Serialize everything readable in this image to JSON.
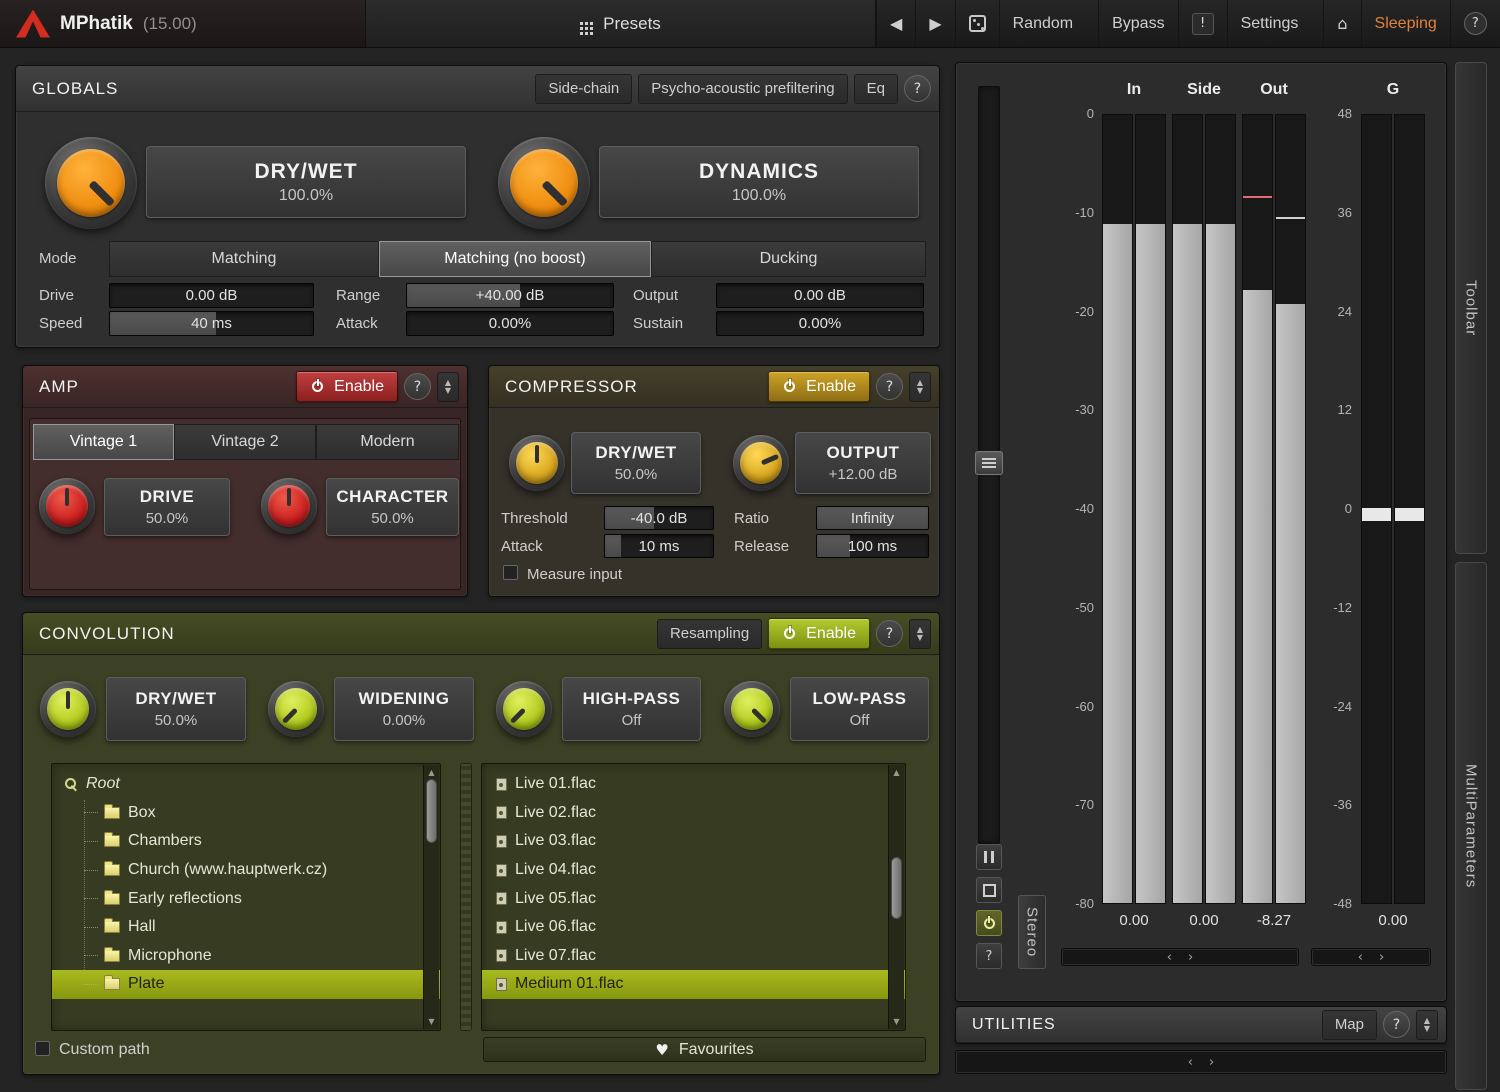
{
  "icons": {
    "back": "◀",
    "forward": "▶",
    "home": "⌂",
    "alert": "!",
    "help": "?",
    "up": "▲",
    "down": "▼",
    "left": "‹",
    "right": "›",
    "heart": "♥"
  },
  "titlebar": {
    "title": "MPhatik",
    "version": "(15.00)",
    "presets": "Presets",
    "random": "Random",
    "bypass": "Bypass",
    "settings": "Settings",
    "sleeping": "Sleeping",
    "sleeping_color": "#e0823a",
    "logo_color": "#d32c20"
  },
  "globals": {
    "title": "GLOBALS",
    "sidechain": "Side-chain",
    "psycho": "Psycho-acoustic prefiltering",
    "eq": "Eq",
    "knobs": [
      {
        "label": "DRY/WET",
        "value": "100.0%"
      },
      {
        "label": "DYNAMICS",
        "value": "100.0%"
      }
    ],
    "mode_label": "Mode",
    "modes": [
      "Matching",
      "Matching (no boost)",
      "Ducking"
    ],
    "selected_mode": "Matching (no boost)",
    "params": [
      {
        "label": "Drive",
        "value": "0.00 dB"
      },
      {
        "label": "Range",
        "value": "+40.00 dB"
      },
      {
        "label": "Output",
        "value": "0.00 dB"
      },
      {
        "label": "Speed",
        "value": "40 ms"
      },
      {
        "label": "Attack",
        "value": "0.00%"
      },
      {
        "label": "Sustain",
        "value": "0.00%"
      }
    ]
  },
  "amp": {
    "title": "AMP",
    "enable": "Enable",
    "accent": "#b23535",
    "tabs": [
      "Vintage 1",
      "Vintage 2",
      "Modern"
    ],
    "selected_tab": "Vintage 1",
    "knobs": [
      {
        "label": "DRIVE",
        "value": "50.0%"
      },
      {
        "label": "CHARACTER",
        "value": "50.0%"
      }
    ]
  },
  "compressor": {
    "title": "COMPRESSOR",
    "enable": "Enable",
    "accent": "#c09a25",
    "knobs": [
      {
        "label": "DRY/WET",
        "value": "50.0%"
      },
      {
        "label": "OUTPUT",
        "value": "+12.00 dB"
      }
    ],
    "fields": [
      {
        "label": "Threshold",
        "value": "-40.0 dB"
      },
      {
        "label": "Ratio",
        "value": "Infinity"
      },
      {
        "label": "Attack",
        "value": "10 ms"
      },
      {
        "label": "Release",
        "value": "100 ms"
      }
    ],
    "measure": "Measure input"
  },
  "convolution": {
    "title": "CONVOLUTION",
    "resampling": "Resampling",
    "enable": "Enable",
    "accent": "#a9ba1e",
    "knobs": [
      {
        "label": "DRY/WET",
        "value": "50.0%"
      },
      {
        "label": "WIDENING",
        "value": "0.00%"
      },
      {
        "label": "HIGH-PASS",
        "value": "Off"
      },
      {
        "label": "LOW-PASS",
        "value": "Off"
      }
    ],
    "tree": {
      "root": "Root",
      "folders": [
        "Box",
        "Chambers",
        "Church (www.hauptwerk.cz)",
        "Early reflections",
        "Hall",
        "Microphone",
        "Plate"
      ],
      "selected": "Plate"
    },
    "files": [
      "Live 01.flac",
      "Live 02.flac",
      "Live 03.flac",
      "Live 04.flac",
      "Live 05.flac",
      "Live 06.flac",
      "Live 07.flac",
      "Medium 01.flac"
    ],
    "selected_file": "Medium 01.flac",
    "custom_path": "Custom path",
    "favourites": "Favourites"
  },
  "meters": {
    "columns": [
      "In",
      "Side",
      "Out",
      "G"
    ],
    "scale_left": [
      "0",
      "-10",
      "-20",
      "-30",
      "-40",
      "-50",
      "-60",
      "-70",
      "-80"
    ],
    "scale_right": [
      "48",
      "36",
      "24",
      "12",
      "0",
      "-12",
      "-24",
      "-36",
      "-48"
    ],
    "readouts": [
      "0.00",
      "0.00",
      "-8.27",
      "0.00"
    ],
    "stereo": "Stereo"
  },
  "utilities": {
    "title": "UTILITIES",
    "map": "Map"
  },
  "edge": {
    "toolbar": "Toolbar",
    "multiparameters": "MultiParameters"
  }
}
